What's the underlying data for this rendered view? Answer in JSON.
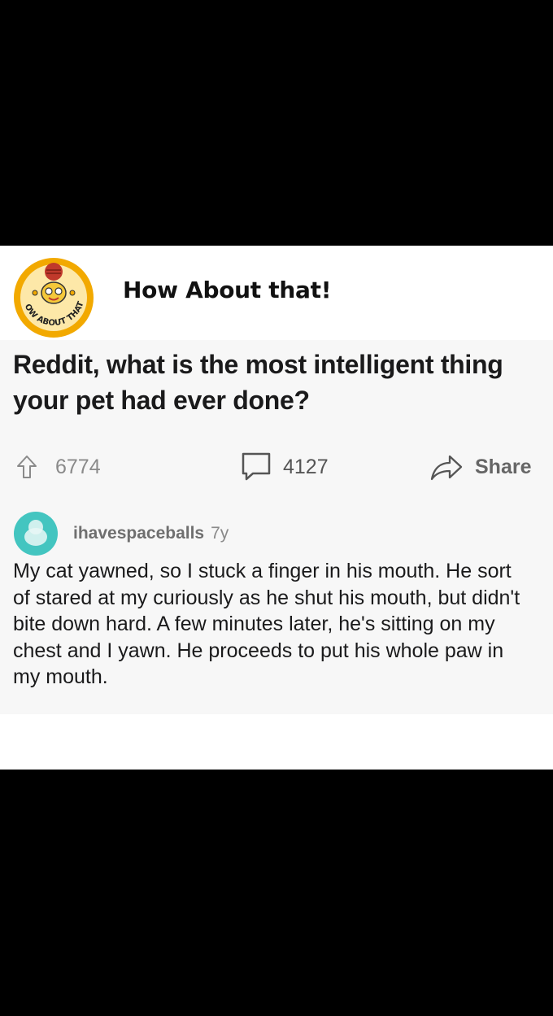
{
  "brand": {
    "name": "How About that!",
    "logo_text": "HOW ABOUT THAT!",
    "logo_icon": "cartoon-character-logo"
  },
  "post": {
    "title": "Reddit, what is the most intelligent thing your pet had ever done?",
    "upvotes": "6774",
    "comments": "4127",
    "share_label": "Share"
  },
  "comment": {
    "username": "ihavespaceballs",
    "age": "7y",
    "avatar_icon": "reddit-avatar",
    "body": "My cat yawned, so I stuck a finger in his mouth. He sort of stared at my curiously as he shut his mouth, but didn't bite down hard. A few minutes later, he's sitting on my chest and I yawn. He proceeds to put his whole paw in my mouth."
  },
  "colors": {
    "logo_ring": "#f2a900",
    "logo_fill": "#fde8a8",
    "avatar_bg": "#43c5c0",
    "text": "#1a1a1b",
    "muted": "#7c7c7c"
  }
}
